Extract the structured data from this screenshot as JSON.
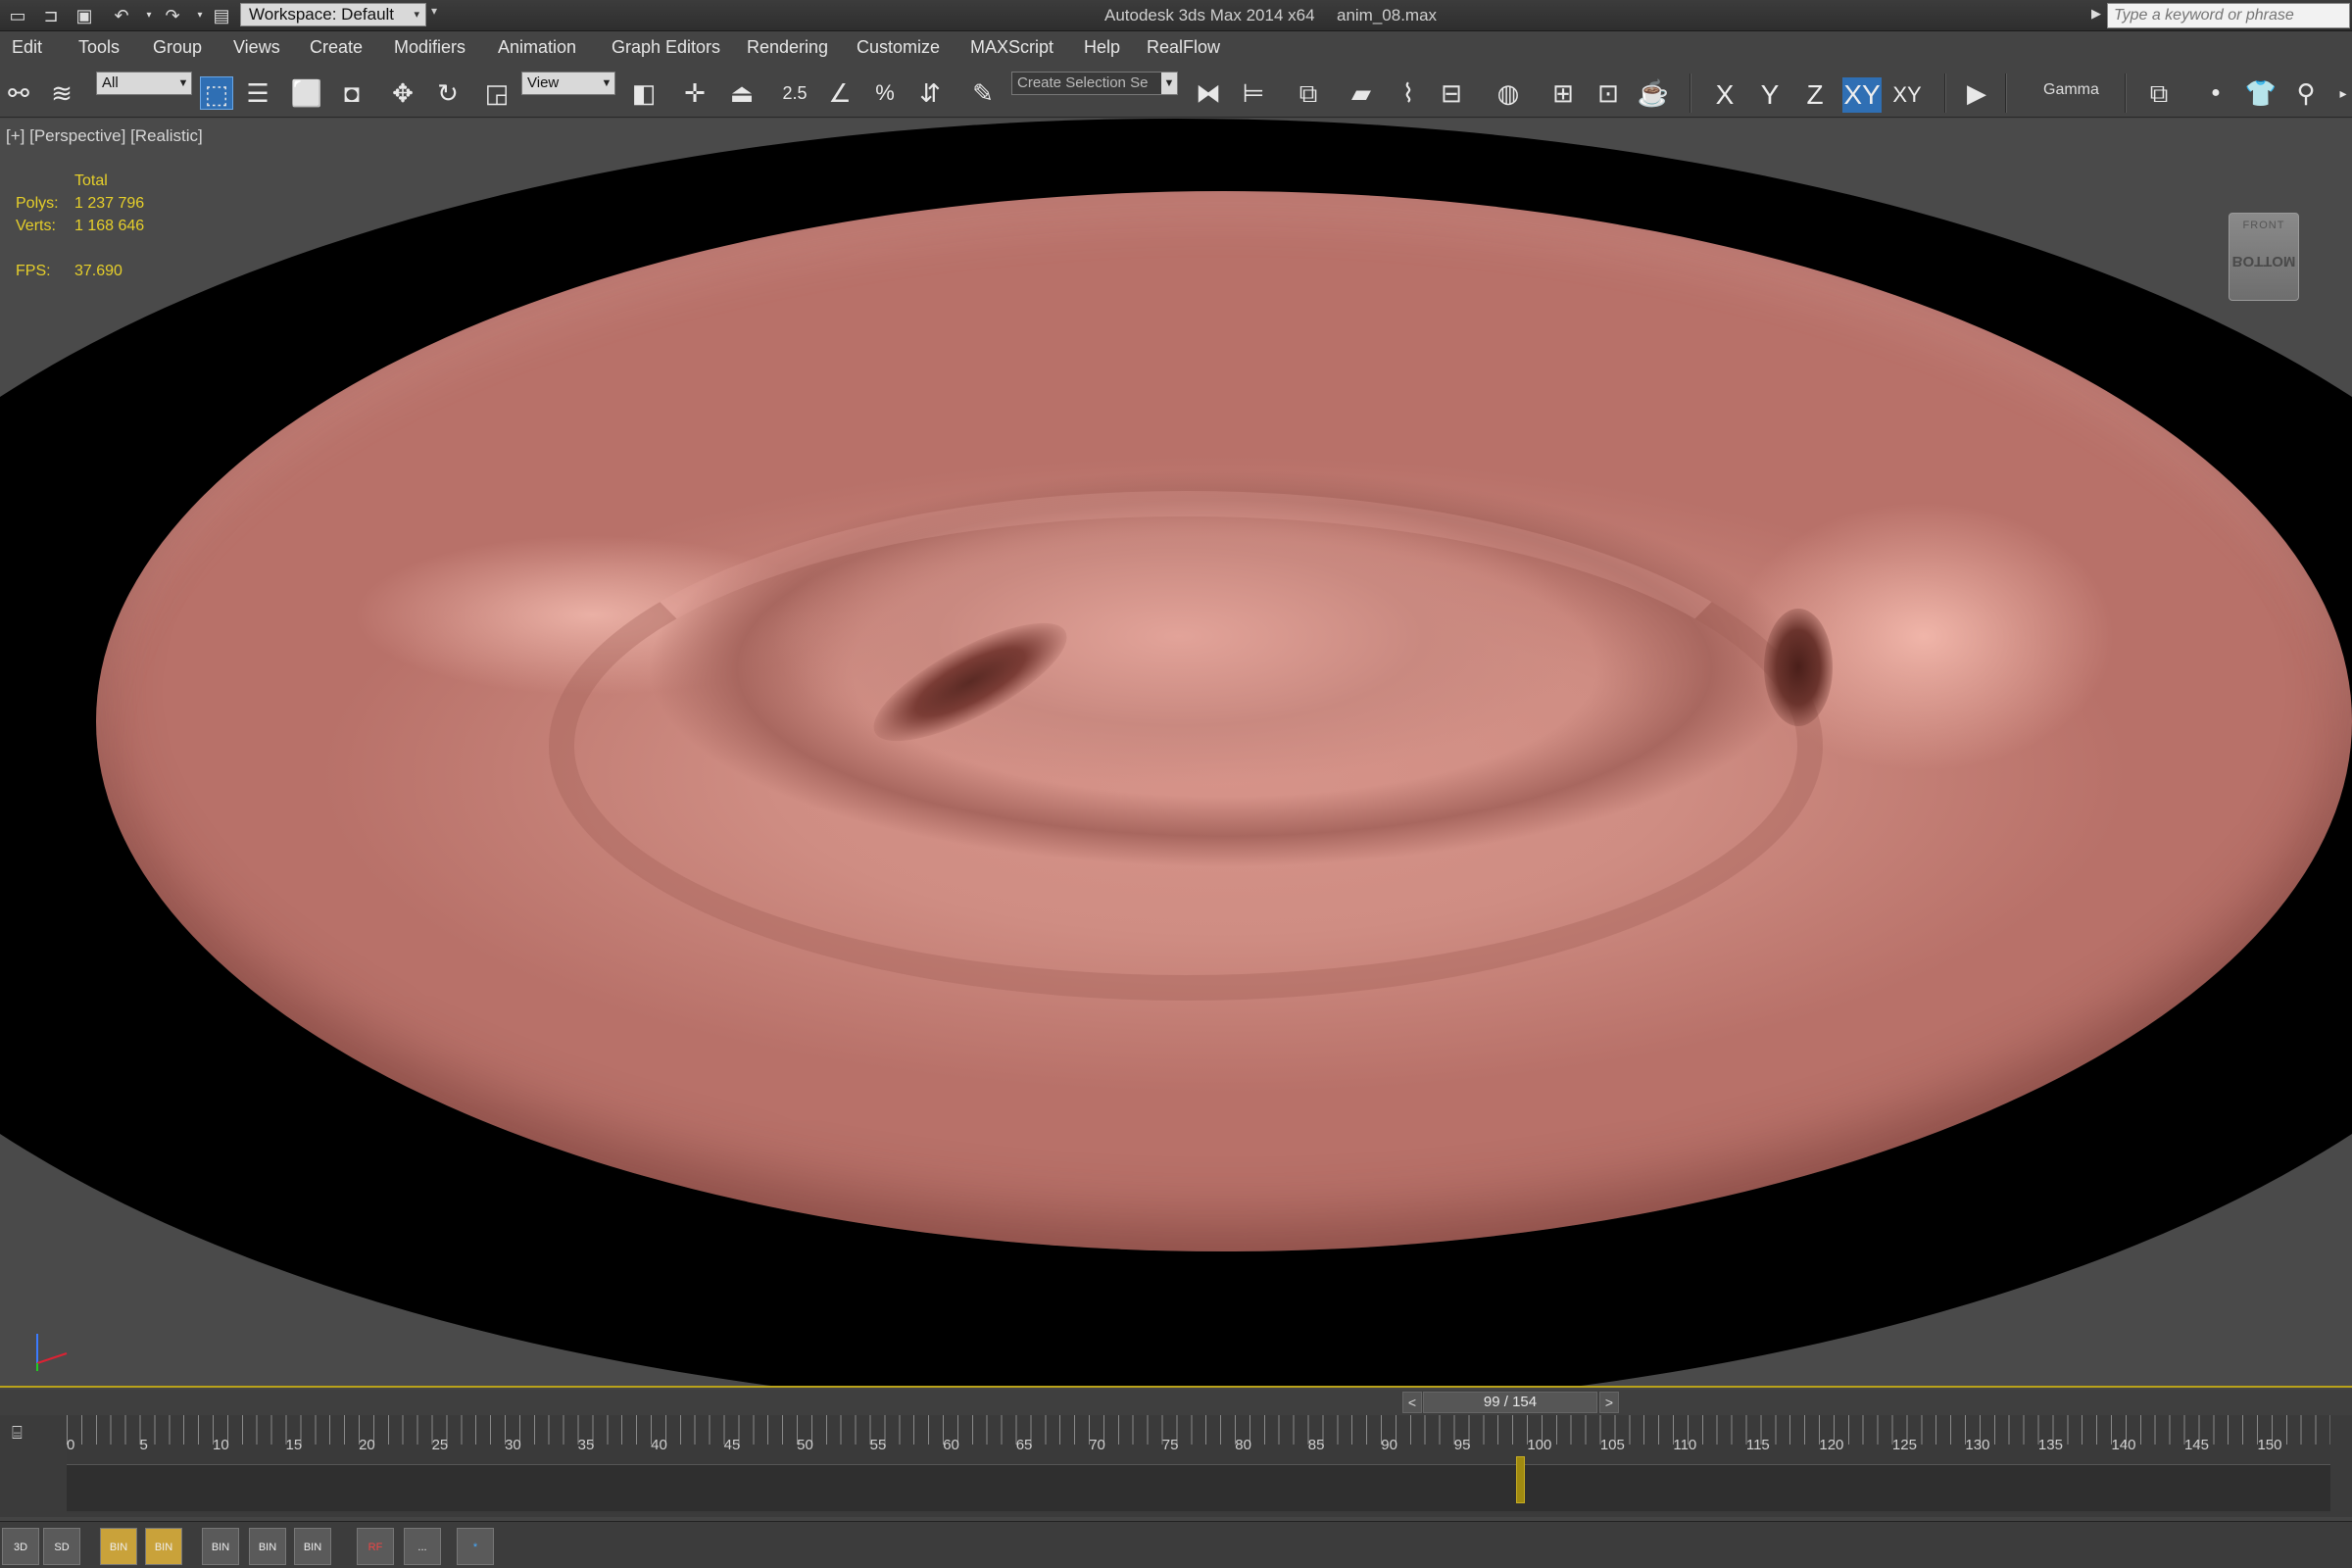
{
  "titlebar": {
    "workspace": "Workspace: Default",
    "app_title": "Autodesk 3ds Max  2014 x64",
    "file_name": "anim_08.max",
    "search_placeholder": "Type a keyword or phrase"
  },
  "menu": [
    "Edit",
    "Tools",
    "Group",
    "Views",
    "Create",
    "Modifiers",
    "Animation",
    "Graph Editors",
    "Rendering",
    "Customize",
    "MAXScript",
    "Help",
    "RealFlow"
  ],
  "toolbar": {
    "filter_value": "All",
    "ref_coord_value": "View",
    "snap_angle_label": "2.5",
    "snap_percent_label": "%",
    "selection_set_placeholder": "Create Selection Se",
    "axes": [
      "X",
      "Y",
      "Z",
      "XY",
      "XY"
    ],
    "active_axis": "XY",
    "gamma_label": "Gamma"
  },
  "viewport": {
    "label": "[+] [Perspective] [Realistic]",
    "stats": {
      "header": "Total",
      "polys_label": "Polys:",
      "polys_value": "1 237 796",
      "verts_label": "Verts:",
      "verts_value": "1 168 646",
      "fps_label": "FPS:",
      "fps_value": "37.690"
    },
    "viewcube": {
      "top_text": "FRONT",
      "face_text": "BOTTOM"
    }
  },
  "timeline": {
    "current_frame_text": "99 / 154",
    "prev_label": "<",
    "next_label": ">",
    "ticks": [
      "0",
      "5",
      "10",
      "15",
      "20",
      "25",
      "30",
      "35",
      "40",
      "45",
      "50",
      "55",
      "60",
      "65",
      "70",
      "75",
      "80",
      "85",
      "90",
      "95",
      "100",
      "105",
      "110",
      "115",
      "120",
      "125",
      "130",
      "135",
      "140",
      "145",
      "150"
    ],
    "current_frame": 99,
    "max_frame": 154
  },
  "shelf": [
    "3D",
    "SD",
    "BIN",
    "BIN",
    "BIN",
    "BIN",
    "BIN",
    "RF",
    "...",
    "*"
  ],
  "colors": {
    "accent_blue": "#2f6fb4",
    "stats_yellow": "#e6cf2a",
    "fluid_pink": "#d69389",
    "playhead": "#a08a10"
  }
}
